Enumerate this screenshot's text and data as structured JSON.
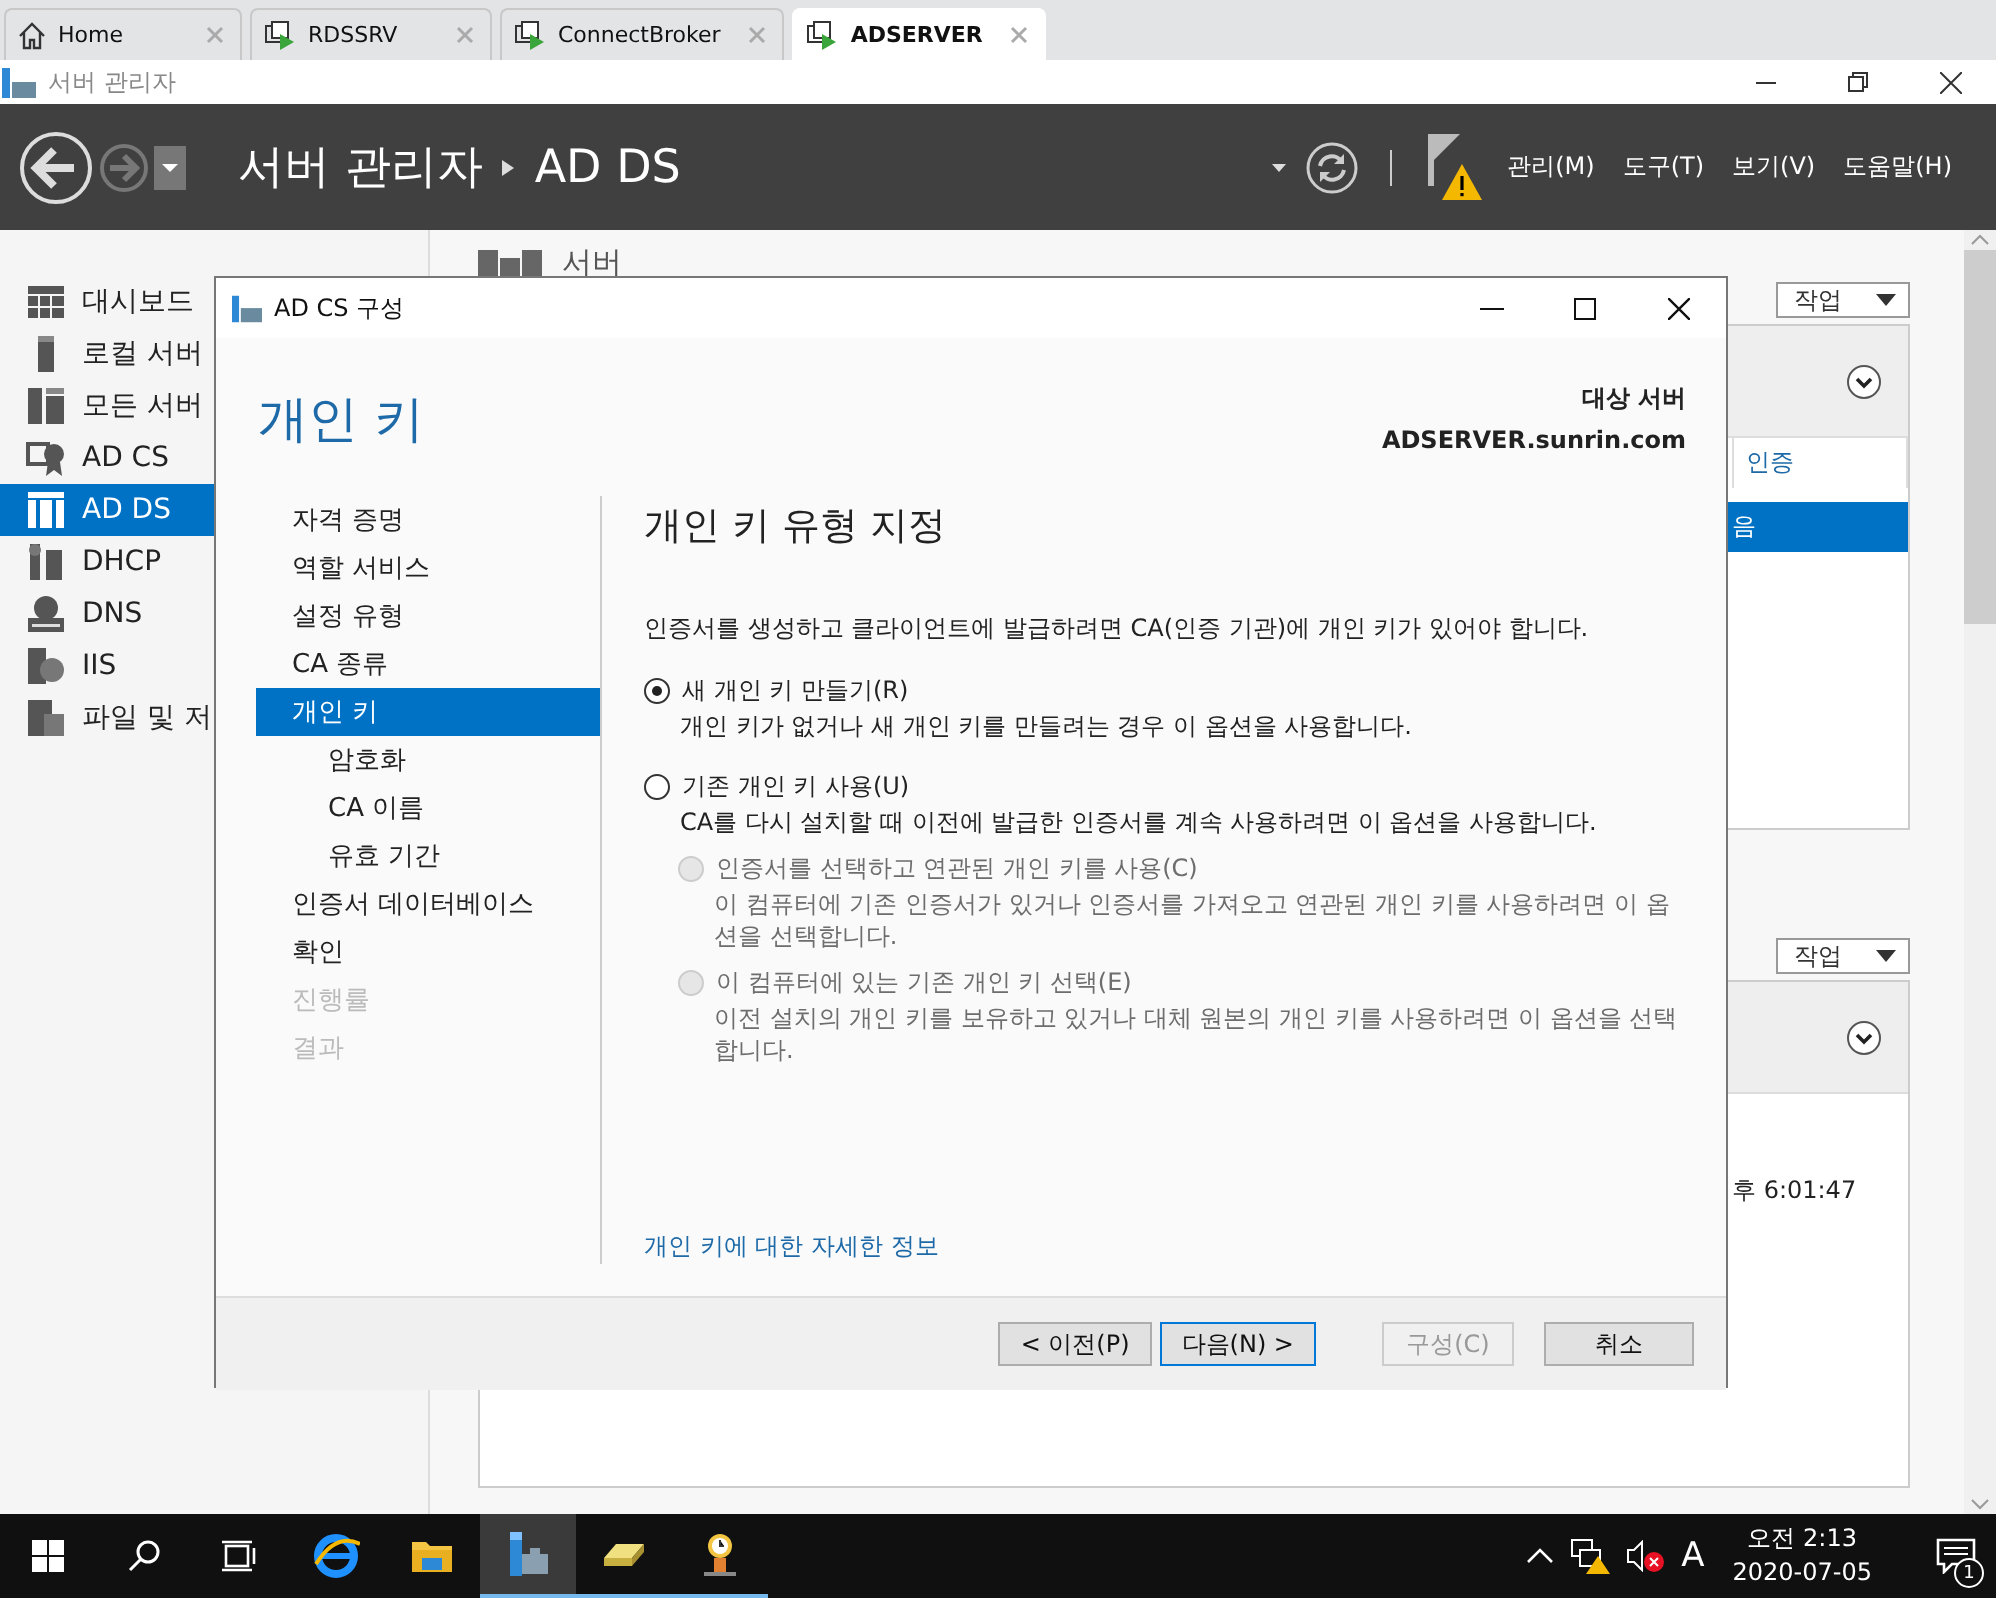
{
  "browser_tabs": [
    {
      "kind": "home",
      "label": "Home",
      "selected": false
    },
    {
      "kind": "remote",
      "label": "RDSSRV",
      "selected": false
    },
    {
      "kind": "remote",
      "label": "ConnectBroker",
      "selected": false
    },
    {
      "kind": "remote",
      "label": "ADSERVER",
      "selected": true
    }
  ],
  "window": {
    "title": "서버 관리자"
  },
  "header": {
    "breadcrumb": [
      "서버 관리자",
      "AD DS"
    ],
    "menus": [
      "관리(M)",
      "도구(T)",
      "보기(V)",
      "도움말(H)"
    ]
  },
  "sidebar": {
    "items": [
      {
        "label": "대시보드",
        "selected": false
      },
      {
        "label": "로컬 서버",
        "selected": false
      },
      {
        "label": "모든 서버",
        "selected": false
      },
      {
        "label": "AD CS",
        "selected": false
      },
      {
        "label": "AD DS",
        "selected": true
      },
      {
        "label": "DHCP",
        "selected": false
      },
      {
        "label": "DNS",
        "selected": false
      },
      {
        "label": "IIS",
        "selected": false
      },
      {
        "label": "파일 및 저",
        "selected": false
      }
    ]
  },
  "content": {
    "heading": "서버",
    "panels": [
      {
        "task_button": "작업",
        "column_header": "인증",
        "cell": "음",
        "cell_selected": true
      },
      {
        "task_button": "작업",
        "cell": "후 6:01:47",
        "cell_selected": false
      }
    ]
  },
  "dialog": {
    "title": "AD CS 구성",
    "page_title": "개인 키",
    "target_label": "대상 서버",
    "target_server": "ADSERVER.sunrin.com",
    "nav": [
      {
        "label": "자격 증명",
        "selected": false,
        "disabled": false
      },
      {
        "label": "역할 서비스",
        "selected": false,
        "disabled": false
      },
      {
        "label": "설정 유형",
        "selected": false,
        "disabled": false
      },
      {
        "label": "CA 종류",
        "selected": false,
        "disabled": false
      },
      {
        "label": "개인 키",
        "selected": true,
        "disabled": false,
        "children": [
          {
            "label": "암호화",
            "selected": false,
            "disabled": false
          },
          {
            "label": "CA 이름",
            "selected": false,
            "disabled": false
          },
          {
            "label": "유효 기간",
            "selected": false,
            "disabled": false
          }
        ]
      },
      {
        "label": "인증서 데이터베이스",
        "selected": false,
        "disabled": false
      },
      {
        "label": "확인",
        "selected": false,
        "disabled": false
      },
      {
        "label": "진행률",
        "selected": false,
        "disabled": true
      },
      {
        "label": "결과",
        "selected": false,
        "disabled": true
      }
    ],
    "section_title": "개인 키 유형 지정",
    "intro": "인증서를 생성하고 클라이언트에 발급하려면 CA(인증 기관)에 개인 키가 있어야 합니다.",
    "options": [
      {
        "label": "새 개인 키 만들기(R)",
        "description": "개인 키가 없거나 새 개인 키를 만들려는 경우 이 옵션을 사용합니다.",
        "selected": true,
        "disabled": false
      },
      {
        "label": "기존 개인 키 사용(U)",
        "description": "CA를 다시 설치할 때 이전에 발급한 인증서를 계속 사용하려면 이 옵션을 사용합니다.",
        "selected": false,
        "disabled": false,
        "children": [
          {
            "label": "인증서를 선택하고 연관된 개인 키를 사용(C)",
            "description": "이 컴퓨터에 기존 인증서가 있거나 인증서를 가져오고 연관된 개인 키를 사용하려면 이 옵션을 선택합니다.",
            "selected": false,
            "disabled": true
          },
          {
            "label": "이 컴퓨터에 있는 기존 개인 키 선택(E)",
            "description": "이전 설치의 개인 키를 보유하고 있거나 대체 원본의 개인 키를 사용하려면 이 옵션을 선택합니다.",
            "selected": false,
            "disabled": true
          }
        ]
      }
    ],
    "link": "개인 키에 대한 자세한 정보",
    "buttons": [
      {
        "label": "< 이전(P)",
        "disabled": false,
        "default": false
      },
      {
        "label": "다음(N) >",
        "disabled": false,
        "default": true
      },
      {
        "label": "구성(C)",
        "disabled": true,
        "default": false
      },
      {
        "label": "취소",
        "disabled": false,
        "default": false
      }
    ]
  },
  "taskbar": {
    "pinned_apps": [
      {
        "kind": "browser",
        "running": false,
        "selected": false
      },
      {
        "kind": "folder",
        "running": false,
        "selected": false
      },
      {
        "kind": "server-manager",
        "running": true,
        "selected": true
      },
      {
        "kind": "drive",
        "running": true,
        "selected": false
      },
      {
        "kind": "clock-figure",
        "running": true,
        "selected": false
      }
    ],
    "input_language": "A",
    "clock_time": "오전 2:13",
    "clock_date": "2020-07-05",
    "notification_count": "1"
  }
}
